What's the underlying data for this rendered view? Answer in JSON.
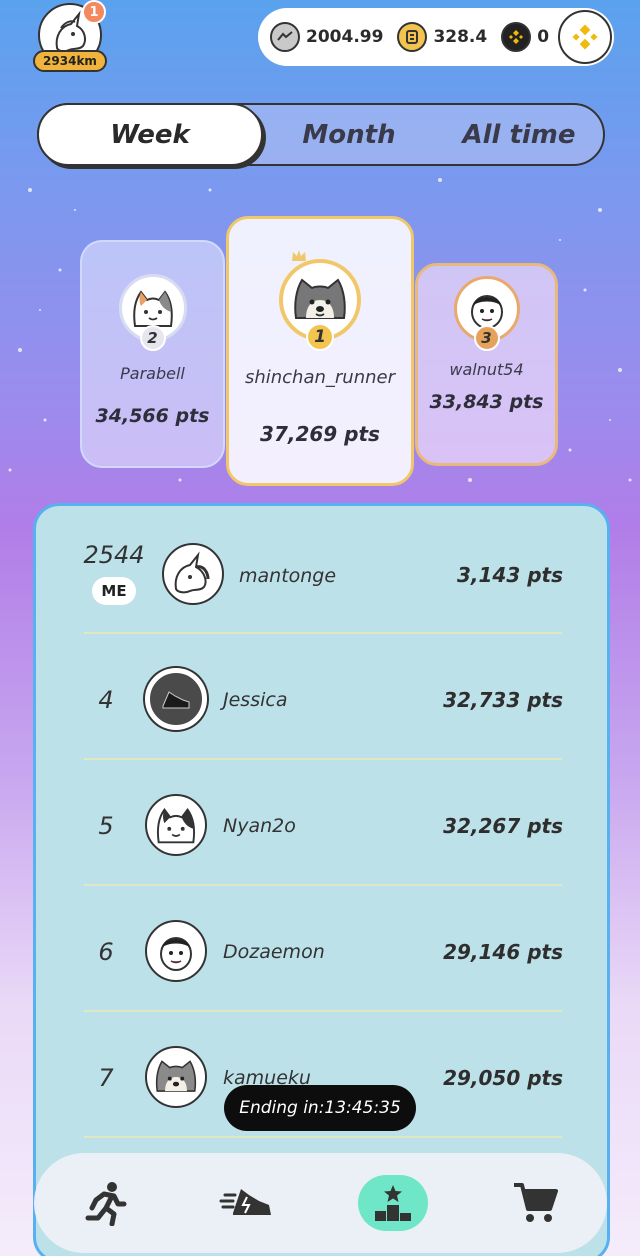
{
  "user": {
    "notification_count": "1",
    "distance": "2934km"
  },
  "wallet": {
    "gst": "2004.99",
    "gmt": "328.4",
    "bnb": "0"
  },
  "tabs": [
    {
      "label": "Week",
      "active": true
    },
    {
      "label": "Month",
      "active": false
    },
    {
      "label": "All time",
      "active": false
    }
  ],
  "podium": {
    "first": {
      "rank": "1",
      "name": "shinchan_runner",
      "points": "37,269 pts"
    },
    "second": {
      "rank": "2",
      "name": "Parabell",
      "points": "34,566 pts"
    },
    "third": {
      "rank": "3",
      "name": "walnut54",
      "points": "33,843 pts"
    }
  },
  "leaderboard": {
    "me": {
      "rank": "2544",
      "badge": "ME",
      "name": "mantonge",
      "points": "3,143 pts"
    },
    "rows": [
      {
        "rank": "4",
        "name": "Jessica",
        "points": "32,733 pts",
        "avatar": "sneaker-icon"
      },
      {
        "rank": "5",
        "name": "Nyan2o",
        "points": "32,267 pts",
        "avatar": "cat-avatar"
      },
      {
        "rank": "6",
        "name": "Dozaemon",
        "points": "29,146 pts",
        "avatar": "boy-avatar"
      },
      {
        "rank": "7",
        "name": "kamueku",
        "points": "29,050 pts",
        "avatar": "dog-avatar"
      }
    ]
  },
  "timer": {
    "text": "Ending in:13:45:35"
  },
  "nav": [
    {
      "icon": "runner-icon",
      "active": false
    },
    {
      "icon": "sneaker-icon",
      "active": false
    },
    {
      "icon": "leaderboard-icon",
      "active": true
    },
    {
      "icon": "cart-icon",
      "active": false
    }
  ],
  "colors": {
    "panel": "#bde1e9",
    "panel_border": "#57b0f0",
    "gold": "#f1c869",
    "bronze": "#e9b97c",
    "active_nav": "#6fe6c8"
  }
}
